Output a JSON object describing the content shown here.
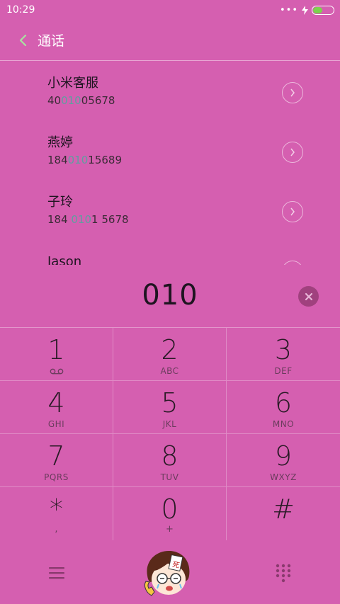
{
  "status_bar": {
    "time": "10:29",
    "dots": "•••"
  },
  "header": {
    "title": "通话"
  },
  "contacts": [
    {
      "name": "小米客服",
      "number_pre": "40",
      "number_match": "010",
      "number_post": "05678"
    },
    {
      "name": "燕婷",
      "number_pre": "184",
      "number_match": "010",
      "number_post": "15689"
    },
    {
      "name": "子玲",
      "number_pre": "184 ",
      "number_match": "010",
      "number_post": "1 5678"
    },
    {
      "name": "Jason",
      "number_pre": "",
      "number_match": "",
      "number_post": ""
    }
  ],
  "dial_input": {
    "value": "010"
  },
  "keypad": {
    "k1": {
      "digit": "1"
    },
    "k2": {
      "digit": "2",
      "letters": "ABC"
    },
    "k3": {
      "digit": "3",
      "letters": "DEF"
    },
    "k4": {
      "digit": "4",
      "letters": "GHI"
    },
    "k5": {
      "digit": "5",
      "letters": "JKL"
    },
    "k6": {
      "digit": "6",
      "letters": "MNO"
    },
    "k7": {
      "digit": "7",
      "letters": "PQRS"
    },
    "k8": {
      "digit": "8",
      "letters": "TUV"
    },
    "k9": {
      "digit": "9",
      "letters": "WXYZ"
    },
    "kstar": {
      "digit": "*",
      "sub": ","
    },
    "k0": {
      "digit": "0",
      "sub": "+"
    },
    "khash": {
      "digit": "#"
    }
  },
  "icons": {
    "back": "chevron-left-icon",
    "clear": "close-icon",
    "menu": "menu-icon",
    "call": "call-avatar-icon",
    "dialpad": "dialpad-icon",
    "voicemail": "voicemail-icon"
  },
  "colors": {
    "background": "#d55fb0",
    "match_highlight": "#5f9ea0",
    "battery": "#7bd34e",
    "back_arrow": "#a8e3a0"
  }
}
